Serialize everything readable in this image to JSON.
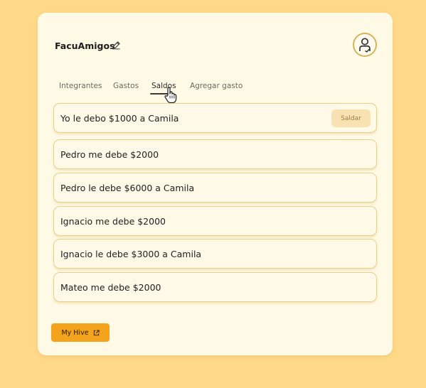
{
  "group": {
    "name": "FacuAmigos"
  },
  "tabs": [
    {
      "label": "Integrantes"
    },
    {
      "label": "Gastos"
    },
    {
      "label": "Saldos"
    },
    {
      "label": "Agregar gasto"
    }
  ],
  "active_tab": "Saldos",
  "balances": [
    {
      "text": "Yo le debo $1000 a Camila",
      "action": "Saldar"
    },
    {
      "text": "Pedro me debe $2000"
    },
    {
      "text": "Pedro le debe $6000 a Camila"
    },
    {
      "text": "Ignacio me debe $2000"
    },
    {
      "text": "Ignacio le debe $3000 a Camila"
    },
    {
      "text": "Mateo me debe $2000"
    }
  ],
  "footer": {
    "button_label": "My Hive"
  },
  "colors": {
    "background": "#ffd98a",
    "card": "#fffae6",
    "accent": "#f4a31c",
    "row_border": "#ead08a",
    "saldar_bg": "#f9e2b2"
  },
  "icons": [
    "edit-icon",
    "user-avatar-icon",
    "hand-pointer-icon",
    "external-link-icon"
  ]
}
